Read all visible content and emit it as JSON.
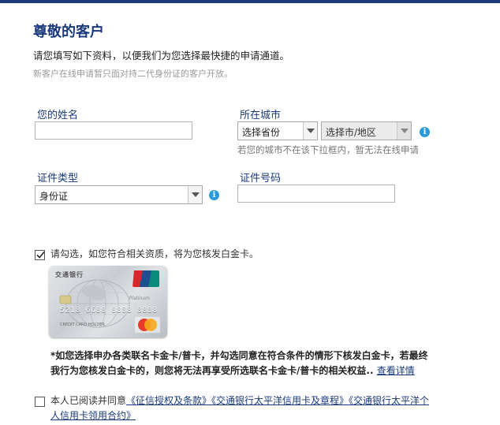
{
  "header": {
    "title": "尊敬的客户",
    "intro": "请您填写如下资料，以便我们为您选择最快捷的申请通道。",
    "note": "新客户在线申请暂只面对持二代身份证的客户开放。"
  },
  "form": {
    "name_label": "您的姓名",
    "name_value": "",
    "city_label": "所在城市",
    "province_select": "选择省份",
    "city_select": "选择市/地区",
    "city_hint": "若您的城市不在该下拉框内，暂无法在线申请",
    "id_type_label": "证件类型",
    "id_type_select": "身份证",
    "id_number_label": "证件号码",
    "id_number_value": "",
    "info_glyph": "i"
  },
  "white_gold": {
    "checked": true,
    "label": "请勾选，如您符合相关资质，将为您核发白金卡。",
    "card": {
      "bank_name": "交通银行",
      "tier": "Platinum",
      "number": "5218 6688 8888 8888",
      "holder": "CREDIT CARD HOLDER"
    },
    "note_text": "*如您选择申办各类联名卡金卡/普卡，并勾选同意在符合条件的情形下核发白金卡，若最终我行为您核发白金卡的，则您将无法再享受所选联名卡金卡/普卡的相关权益..",
    "note_link": "查看详情"
  },
  "agreement": {
    "checked": false,
    "prefix": "本人已阅读并同意",
    "link1": "《征信授权及条款》",
    "link2": "《交通银行太平洋信用卡及章程》",
    "link3": "《交通银行太平洋个人信用卡领用合约》"
  },
  "colors": {
    "accent": "#1a3a7c",
    "info": "#2a9bd7"
  }
}
